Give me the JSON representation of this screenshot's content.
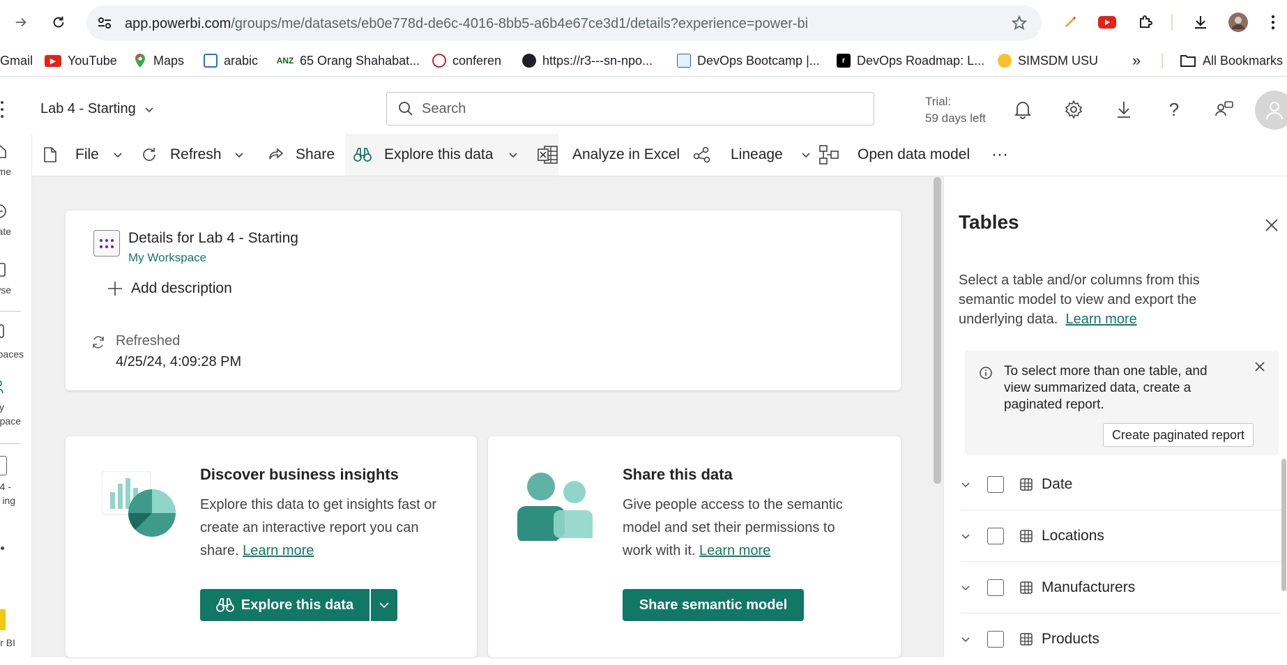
{
  "browser": {
    "url_host": "app.powerbi.com",
    "url_path": "/groups/me/datasets/eb0e778d-de6c-4016-8bb5-a6b4e67ce3d1/details?experience=power-bi",
    "bookmarks": [
      "Gmail",
      "YouTube",
      "Maps",
      "arabic",
      "65 Orang Shahabat...",
      "conferen",
      "https://r3---sn-npo...",
      "DevOps Bootcamp |...",
      "DevOps Roadmap: L...",
      "SIMSDM USU"
    ],
    "all_bookmarks_label": "All Bookmarks",
    "more_label": "»"
  },
  "header": {
    "workspace_title": "Lab 4 - Starting",
    "search_placeholder": "Search",
    "trial_line1": "Trial:",
    "trial_line2": "59 days left"
  },
  "leftnav": {
    "items": [
      "me",
      "ate",
      "wse",
      "paces",
      "y",
      "pace",
      "4 -",
      "ing",
      "er BI"
    ]
  },
  "ribbon": {
    "file": "File",
    "refresh": "Refresh",
    "share": "Share",
    "explore": "Explore this data",
    "analyze": "Analyze in Excel",
    "lineage": "Lineage",
    "open_model": "Open data model",
    "more": "···"
  },
  "details": {
    "title": "Details for Lab 4 - Starting",
    "workspace": "My Workspace",
    "add_description": "Add description",
    "refreshed_label": "Refreshed",
    "refreshed_value": "4/25/24, 4:09:28 PM"
  },
  "insights": {
    "title": "Discover business insights",
    "body": "Explore this data to get insights fast or create an interactive report you can share.",
    "link": "Learn more",
    "button": "Explore this data"
  },
  "share_card": {
    "title": "Share this data",
    "body": "Give people access to the semantic model and set their permissions to work with it.",
    "link": "Learn more",
    "button": "Share semantic model"
  },
  "pane": {
    "title": "Tables",
    "description": "Select a table and/or columns from this semantic model to view and export the underlying data.",
    "learn_more": "Learn more",
    "info_text": "To select more than one table, and view summarized data, create a paginated report.",
    "info_button": "Create paginated report",
    "tables": [
      "Date",
      "Locations",
      "Manufacturers",
      "Products"
    ]
  },
  "colors": {
    "accent": "#117865",
    "canvas": "#f0f0f0"
  }
}
